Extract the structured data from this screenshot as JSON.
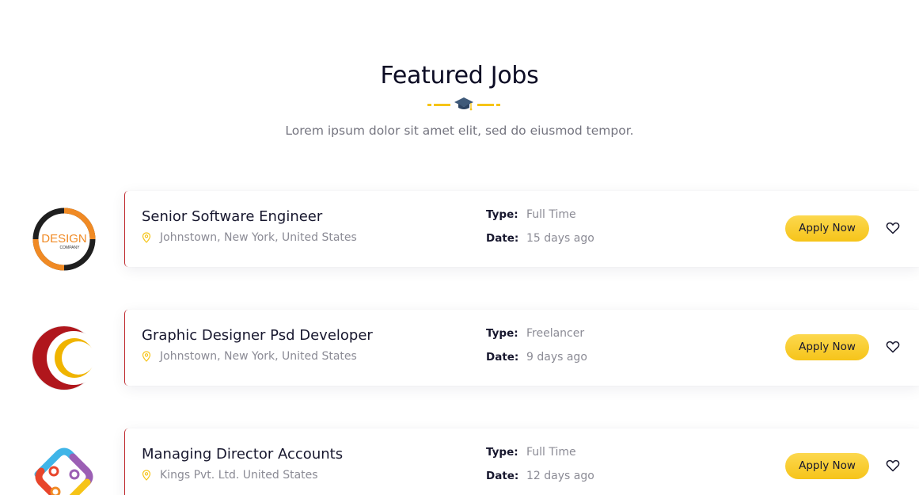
{
  "section": {
    "title": "Featured Jobs",
    "divider_icon": "graduation-cap-icon",
    "subtitle": "Lorem ipsum dolor sit amet elit, sed do eiusmod tempor."
  },
  "colors": {
    "accent": "#f6c417",
    "title": "#0c0c24",
    "muted": "#8b8b95",
    "card_border": "#c0282d"
  },
  "jobs": [
    {
      "logo": "design-company-logo",
      "logo_text": "DESIGN",
      "logo_subtext": "COMPANY",
      "title": "Senior Software Engineer",
      "location": "Johnstown, New York, United States",
      "type_label": "Type:",
      "type": "Full Time",
      "date_label": "Date:",
      "date": "15 days ago",
      "apply_label": "Apply Now"
    },
    {
      "logo": "crescent-ring-logo",
      "title": "Graphic Designer Psd Developer",
      "location": "Johnstown, New York, United States",
      "type_label": "Type:",
      "type": "Freelancer",
      "date_label": "Date:",
      "date": "9 days ago",
      "apply_label": "Apply Now"
    },
    {
      "logo": "colorful-link-logo",
      "title": "Managing Director Accounts",
      "location": "Kings Pvt. Ltd. United States",
      "type_label": "Type:",
      "type": "Full Time",
      "date_label": "Date:",
      "date": "12 days ago",
      "apply_label": "Apply Now"
    }
  ]
}
